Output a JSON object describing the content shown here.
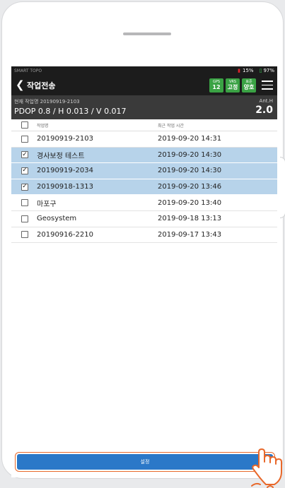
{
  "status": {
    "app_name": "SMART TOPO",
    "receiver_battery": "15%",
    "phone_battery": "97%"
  },
  "topbar": {
    "title": "작업전송",
    "badges": [
      {
        "label": "GPS",
        "value": "12"
      },
      {
        "label": "VRS",
        "value": "고정"
      },
      {
        "label": "표준",
        "value": "양호"
      }
    ]
  },
  "info": {
    "current_job": "현재 작업명 20190919-2103",
    "pdop": "PDOP 0.8 / H 0.013 / V 0.017",
    "ant_label": "Ant.H",
    "ant_value": "2.0"
  },
  "table": {
    "col_name": "작업명",
    "col_date": "최근 작업 시간",
    "rows": [
      {
        "name": "20190919-2103",
        "date": "2019-09-20 14:31",
        "checked": false
      },
      {
        "name": "경사보정 테스트",
        "date": "2019-09-20 14:30",
        "checked": true
      },
      {
        "name": "20190919-2034",
        "date": "2019-09-20 14:30",
        "checked": true
      },
      {
        "name": "20190918-1313",
        "date": "2019-09-20 13:46",
        "checked": true
      },
      {
        "name": "마포구",
        "date": "2019-09-20 13:40",
        "checked": false
      },
      {
        "name": "Geosystem",
        "date": "2019-09-18 13:13",
        "checked": false
      },
      {
        "name": "20190916-2210",
        "date": "2019-09-17 13:43",
        "checked": false
      }
    ]
  },
  "confirm_label": "설정",
  "colors": {
    "accent": "#2b78c8",
    "selected_row": "#b7d3ea",
    "badge_green": "#3aa244",
    "highlight": "#e8682a"
  }
}
